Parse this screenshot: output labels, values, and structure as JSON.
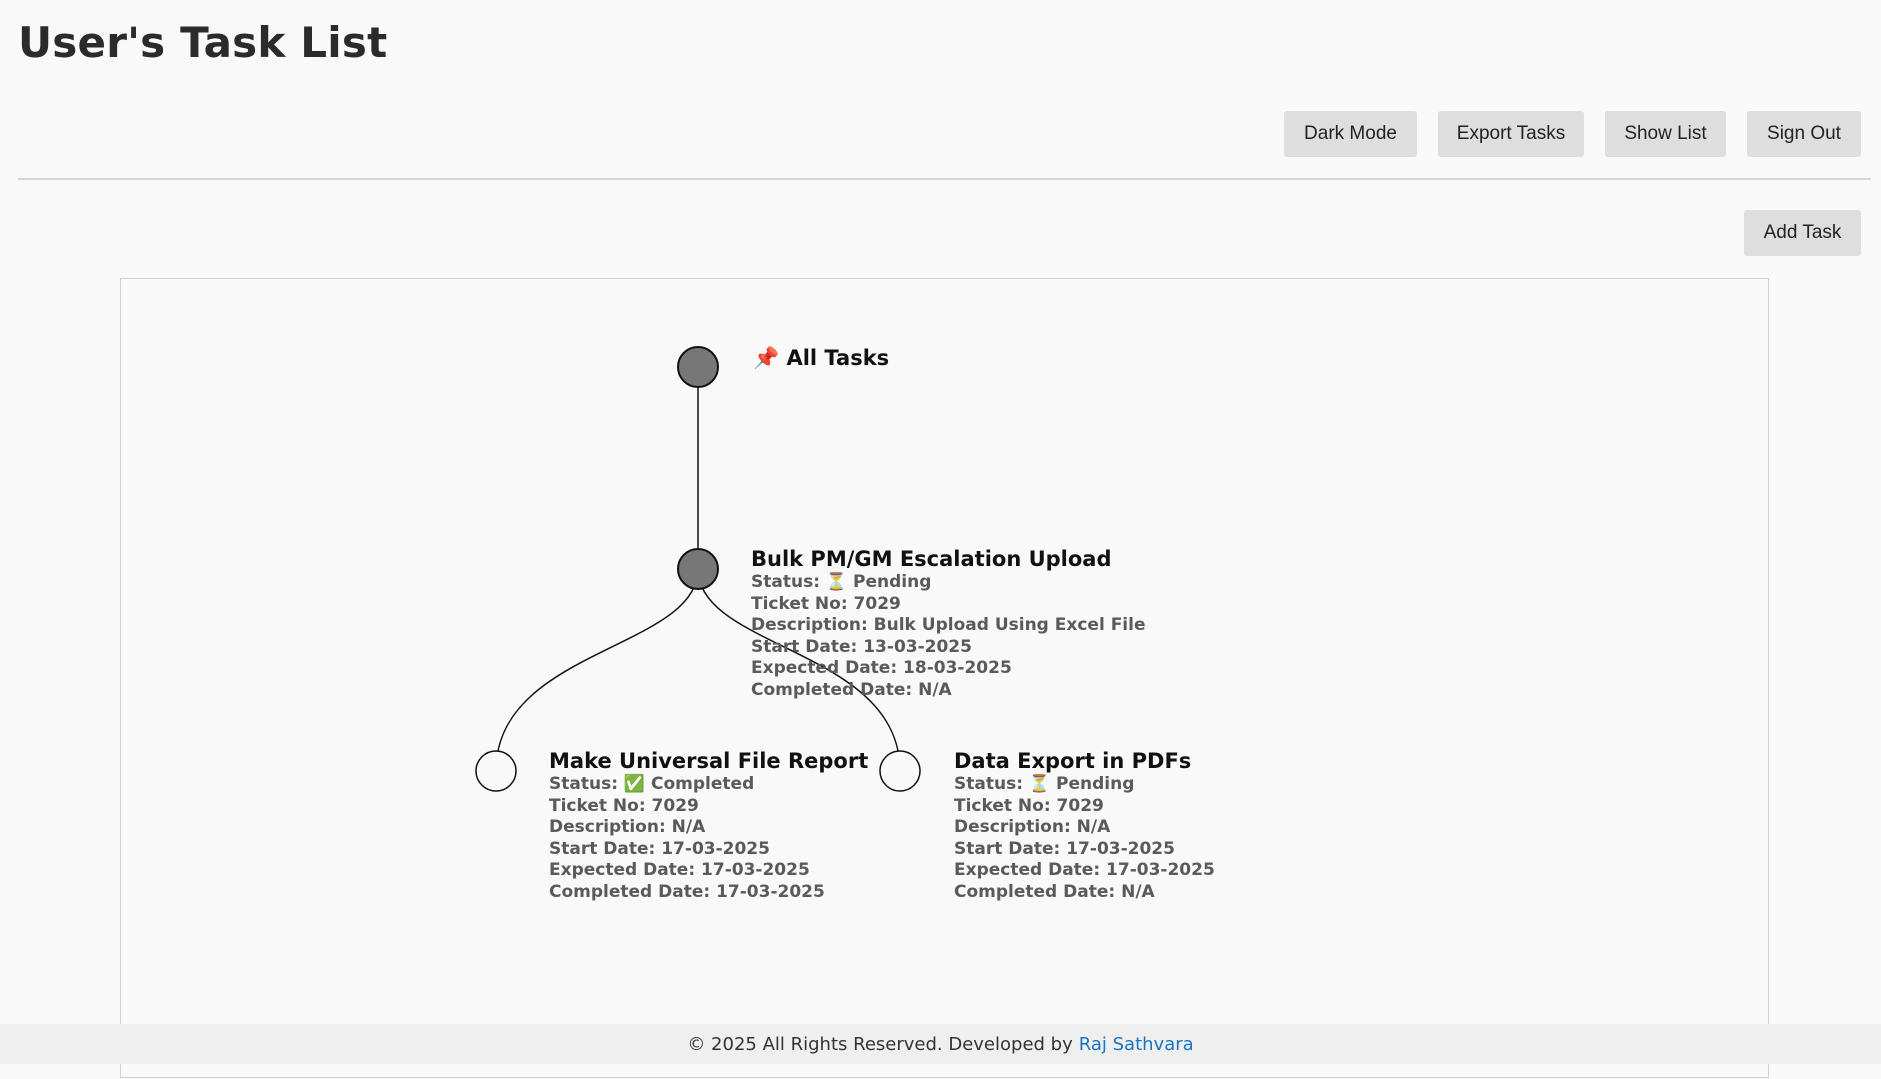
{
  "header": {
    "title": "User's Task List",
    "buttons": {
      "dark_mode": "Dark Mode",
      "export_tasks": "Export Tasks",
      "show_list": "Show List",
      "sign_out": "Sign Out"
    },
    "add_task": "Add Task"
  },
  "tree": {
    "root": {
      "icon": "pushpin-icon",
      "pin_glyph": "📌",
      "label": "All Tasks"
    },
    "parent": {
      "title": "Bulk PM/GM Escalation Upload",
      "status_label": "Status:",
      "status_icon": "hourglass-icon",
      "status_glyph": "⏳",
      "status": "Pending",
      "ticket": "Ticket No: 7029",
      "description": "Description: Bulk Upload Using Excel File",
      "start": "Start Date: 13-03-2025",
      "expected": "Expected Date: 18-03-2025",
      "completed": "Completed Date: N/A"
    },
    "children": [
      {
        "title": "Make Universal File Report",
        "status_label": "Status:",
        "status_icon": "check-box-icon",
        "status_glyph": "✅",
        "status": "Completed",
        "ticket": "Ticket No: 7029",
        "description": "Description: N/A",
        "start": "Start Date: 17-03-2025",
        "expected": "Expected Date: 17-03-2025",
        "completed": "Completed Date: 17-03-2025"
      },
      {
        "title": "Data Export in PDFs",
        "status_label": "Status:",
        "status_icon": "hourglass-icon",
        "status_glyph": "⏳",
        "status": "Pending",
        "ticket": "Ticket No: 7029",
        "description": "Description: N/A",
        "start": "Start Date: 17-03-2025",
        "expected": "Expected Date: 17-03-2025",
        "completed": "Completed Date: N/A"
      }
    ]
  },
  "footer": {
    "text": "© 2025 All Rights Reserved. Developed by",
    "author": "Raj Sathvara"
  },
  "colors": {
    "background": "#f9f9f9",
    "button": "#dedede",
    "node_filled": "#777777",
    "link": "#1a73c8"
  }
}
